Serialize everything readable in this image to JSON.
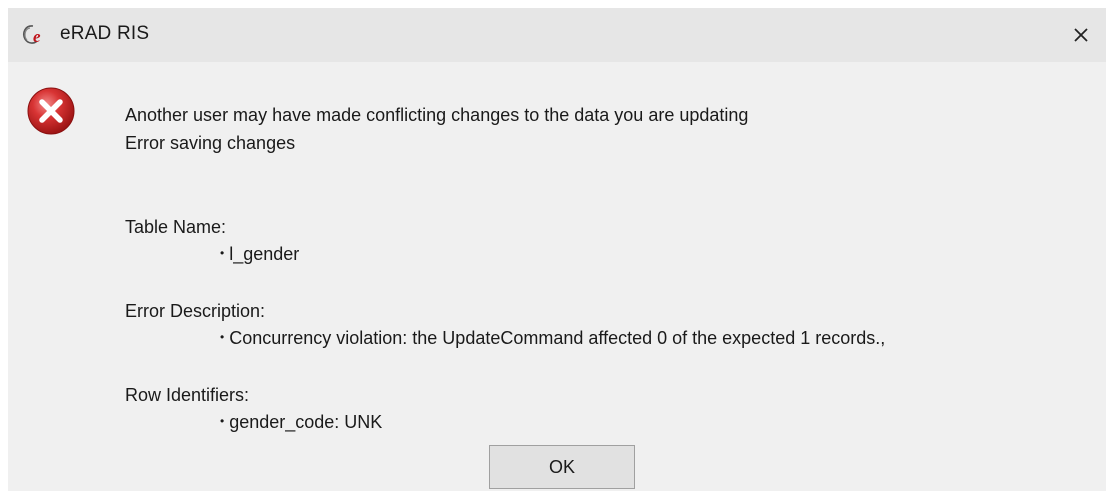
{
  "window": {
    "title": "eRAD RIS",
    "close_glyph": "✕",
    "icon": "erad-logo-icon"
  },
  "message": {
    "icon": "error-icon",
    "line1": "Another user may have made conflicting changes to the data you are updating",
    "line2": "Error saving changes"
  },
  "details": {
    "table_name_label": "Table Name:",
    "table_name_value": "l_gender",
    "error_description_label": "Error Description:",
    "error_description_value": "Concurrency violation: the UpdateCommand affected 0 of the expected 1 records.,",
    "row_identifiers_label": "Row Identifiers:",
    "row_identifiers_value": "gender_code: UNK"
  },
  "buttons": {
    "ok_label": "OK"
  },
  "colors": {
    "error_red": "#d22a2a",
    "titlebar_bg": "#e6e6e6",
    "dialog_bg": "#f0f0f0"
  }
}
